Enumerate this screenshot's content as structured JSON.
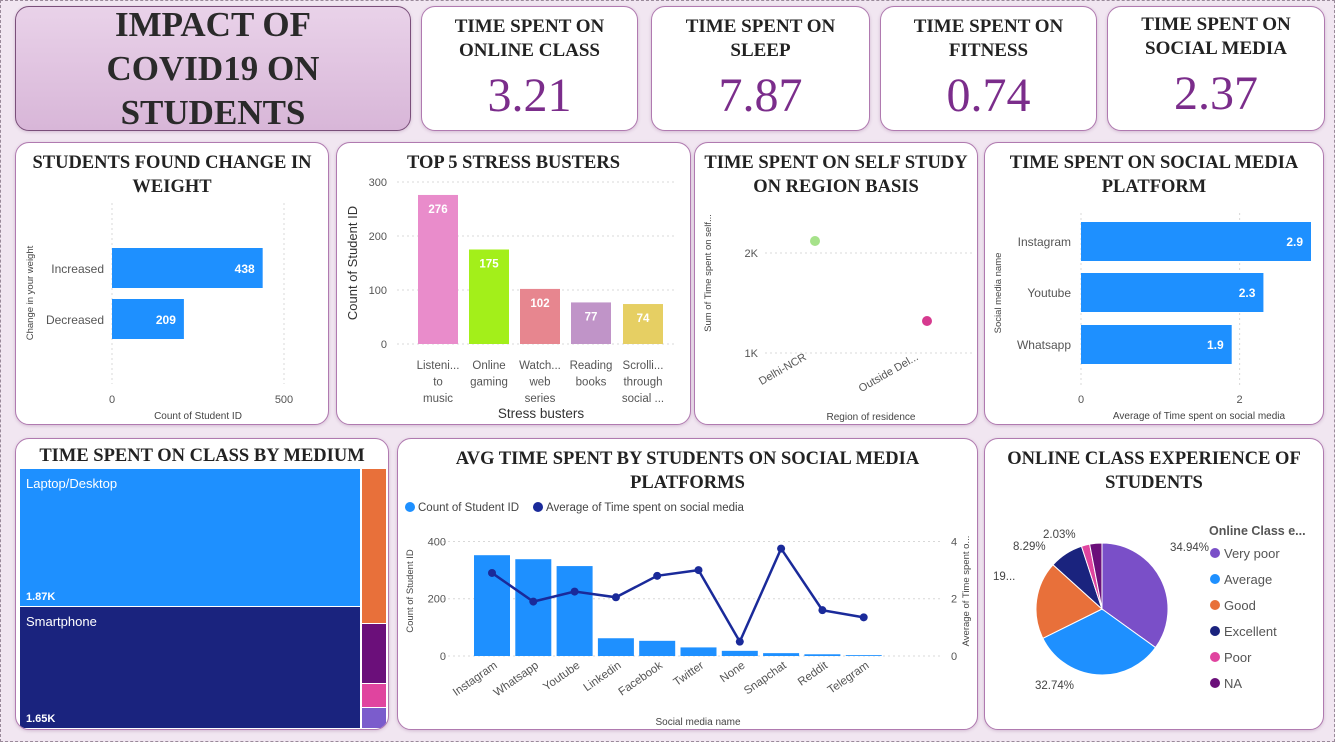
{
  "title": "IMPACT OF COVID19 ON STUDENTS",
  "kpis": [
    {
      "label": "TIME SPENT ON ONLINE CLASS",
      "value": "3.21"
    },
    {
      "label": "TIME SPENT ON SLEEP",
      "value": "7.87"
    },
    {
      "label": "TIME SPENT ON FITNESS",
      "value": "0.74"
    },
    {
      "label": "TIME SPENT ON SOCIAL MEDIA",
      "value": "2.37"
    }
  ],
  "colors": {
    "accent": "#7b2d8b",
    "bar": "#1e90ff",
    "dark": "#1a237e"
  },
  "chart_data": [
    {
      "id": "weight",
      "type": "bar",
      "orientation": "horizontal",
      "title": "STUDENTS FOUND CHANGE IN WEIGHT",
      "categories": [
        "Increased",
        "Decreased"
      ],
      "values": [
        438,
        209
      ],
      "data_labels": [
        "438",
        "209"
      ],
      "xlabel": "Count of Student ID",
      "ylabel": "Change in your weight",
      "xlim": [
        0,
        500
      ],
      "ticks": [
        "0",
        "500"
      ],
      "color": "#1e90ff"
    },
    {
      "id": "stress",
      "type": "bar",
      "title": "TOP 5 STRESS BUSTERS",
      "categories": [
        [
          "Listeni...",
          "to",
          "music"
        ],
        [
          "Online",
          "gaming"
        ],
        [
          "Watch...",
          "web",
          "series"
        ],
        [
          "Reading",
          "books"
        ],
        [
          "Scrolli...",
          "through",
          "social ..."
        ]
      ],
      "values": [
        276,
        175,
        102,
        77,
        74
      ],
      "data_labels": [
        "276",
        "175",
        "102",
        "77",
        "74"
      ],
      "colors": [
        "#e98ccb",
        "#a3ef1a",
        "#e7868f",
        "#c094c8",
        "#e6cf63"
      ],
      "xlabel": "Stress busters",
      "ylabel": "Count of Student ID",
      "ylim": [
        0,
        300
      ],
      "ticks": [
        "0",
        "100",
        "200",
        "300"
      ]
    },
    {
      "id": "selfstudy",
      "type": "scatter",
      "title": "TIME SPENT ON SELF STUDY ON REGION BASIS",
      "categories": [
        "Delhi-NCR",
        "Outside Del..."
      ],
      "values": [
        2120,
        1320
      ],
      "colors": [
        "#a6e28a",
        "#d63a8f"
      ],
      "xlabel": "Region of residence",
      "ylabel": "Sum of Time spent on self...",
      "ylim": [
        800,
        2400
      ],
      "ticks": [
        {
          "v": 1000,
          "t": "1K"
        },
        {
          "v": 2000,
          "t": "2K"
        }
      ]
    },
    {
      "id": "socialplat",
      "type": "bar",
      "orientation": "horizontal",
      "title": "TIME SPENT ON SOCIAL MEDIA PLATFORM",
      "categories": [
        "Instagram",
        "Youtube",
        "Whatsapp"
      ],
      "values": [
        2.9,
        2.3,
        1.9
      ],
      "data_labels": [
        "2.9",
        "2.3",
        "1.9"
      ],
      "xlabel": "Average of Time spent on social media",
      "ylabel": "Social media name",
      "xlim": [
        0,
        2.9
      ],
      "ticks": [
        "0",
        "2"
      ],
      "color": "#1e90ff"
    },
    {
      "id": "treemap",
      "type": "treemap",
      "title": "TIME SPENT ON CLASS BY MEDIUM",
      "items": [
        {
          "name": "Laptop/Desktop",
          "label": "1.87K",
          "color": "#1e90ff"
        },
        {
          "name": "Smartphone",
          "label": "1.65K",
          "color": "#1a237e"
        },
        {
          "name": "",
          "label": "",
          "color": "#e8703a"
        },
        {
          "name": "",
          "label": "",
          "color": "#6b0f7a"
        },
        {
          "name": "",
          "label": "",
          "color": "#e0449f"
        },
        {
          "name": "",
          "label": "",
          "color": "#7b5ccc"
        }
      ]
    },
    {
      "id": "combo",
      "type": "bar",
      "title": "AVG TIME SPENT BY STUDENTS ON SOCIAL MEDIA PLATFORMS",
      "categories": [
        "Instagram",
        "Whatsapp",
        "Youtube",
        "Linkedin",
        "Facebook",
        "Twitter",
        "None",
        "Snapchat",
        "Reddit",
        "Telegram"
      ],
      "series": [
        {
          "name": "Count of Student ID",
          "type": "bar",
          "color": "#1e90ff",
          "values": [
            352,
            338,
            314,
            62,
            53,
            30,
            18,
            10,
            6,
            3
          ]
        },
        {
          "name": "Average of Time spent on social media",
          "type": "line",
          "color": "#1a2a9a",
          "values": [
            2.9,
            1.9,
            2.25,
            2.05,
            2.8,
            3.0,
            0.5,
            3.75,
            1.6,
            1.35
          ]
        }
      ],
      "xlabel": "Social media name",
      "ylabel": "Count of Student ID",
      "y2label": "Average of Time spent o...",
      "ylim": [
        0,
        440
      ],
      "y2lim": [
        0,
        4.4
      ],
      "ticks": [
        "0",
        "200",
        "400"
      ],
      "ticks2": [
        "0",
        "2",
        "4"
      ]
    },
    {
      "id": "pie",
      "type": "pie",
      "title": "ONLINE CLASS EXPERIENCE OF STUDENTS",
      "legend_title": "Online Class e...",
      "slices": [
        {
          "name": "Very poor",
          "value": 34.94,
          "label": "34.94%",
          "color": "#7a4fc8"
        },
        {
          "name": "Average",
          "value": 32.74,
          "label": "32.74%",
          "color": "#1e90ff"
        },
        {
          "name": "Good",
          "value": 19.0,
          "label": "19...",
          "color": "#e8703a"
        },
        {
          "name": "Excellent",
          "value": 8.29,
          "label": "8.29%",
          "color": "#1a237e"
        },
        {
          "name": "Poor",
          "value": 2.03,
          "label": "2.03%",
          "color": "#e0449f"
        },
        {
          "name": "NA",
          "value": 3.0,
          "label": "",
          "color": "#6b0f7a"
        }
      ]
    }
  ]
}
